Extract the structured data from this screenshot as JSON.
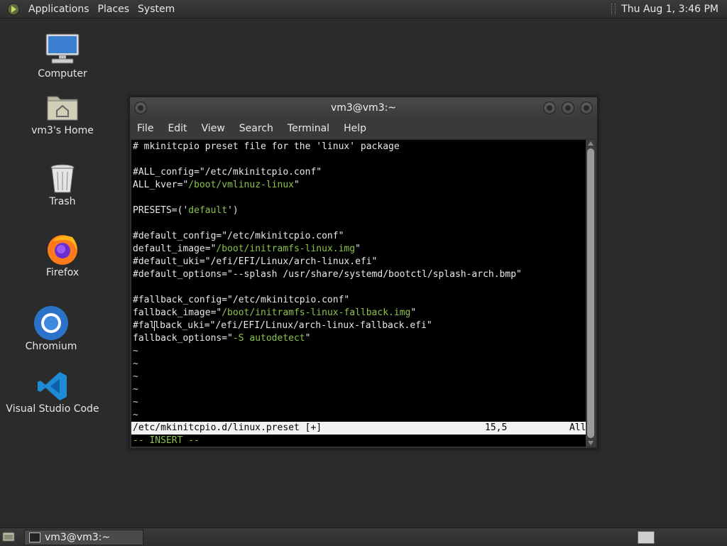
{
  "top_panel": {
    "menus": [
      "Applications",
      "Places",
      "System"
    ],
    "clock": "Thu Aug  1,  3:46 PM"
  },
  "desktop_icons": [
    {
      "label": "Computer",
      "icon": "computer-icon"
    },
    {
      "label": "vm3's Home",
      "icon": "home-folder-icon"
    },
    {
      "label": "Trash",
      "icon": "trash-icon"
    },
    {
      "label": "Firefox",
      "icon": "firefox-icon"
    },
    {
      "label": "Chromium",
      "icon": "chromium-icon"
    },
    {
      "label": "Visual Studio Code",
      "icon": "vscode-icon"
    }
  ],
  "window": {
    "title": "vm3@vm3:~",
    "menu": [
      "File",
      "Edit",
      "View",
      "Search",
      "Terminal",
      "Help"
    ]
  },
  "terminal": {
    "lines": [
      "# mkinitcpio preset file for the 'linux' package",
      "",
      "#ALL_config=\"/etc/mkinitcpio.conf\"",
      "ALL_kver=\"/boot/vmlinuz-linux\"",
      "",
      "PRESETS=('default')",
      "",
      "#default_config=\"/etc/mkinitcpio.conf\"",
      "default_image=\"/boot/initramfs-linux.img\"",
      "#default_uki=\"/efi/EFI/Linux/arch-linux.efi\"",
      "#default_options=\"--splash /usr/share/systemd/bootctl/splash-arch.bmp\"",
      "",
      "#fallback_config=\"/etc/mkinitcpio.conf\"",
      "fallback_image=\"/boot/initramfs-linux-fallback.img\"",
      "#fallback_uki=\"/efi/EFI/Linux/arch-linux-fallback.efi\"",
      "fallback_options=\"-S autodetect\"",
      "~",
      "~",
      "~",
      "~",
      "~",
      "~"
    ],
    "status_file": "/etc/mkinitcpio.d/linux.preset [+]",
    "status_pos": "15,5",
    "status_scroll": "All",
    "mode": "-- INSERT --"
  },
  "taskbar": {
    "task_label": "vm3@vm3:~"
  },
  "colors": {
    "string": "#8bc34a",
    "terminal_bg": "#000000",
    "desktop_bg": "#2b2b2b"
  }
}
